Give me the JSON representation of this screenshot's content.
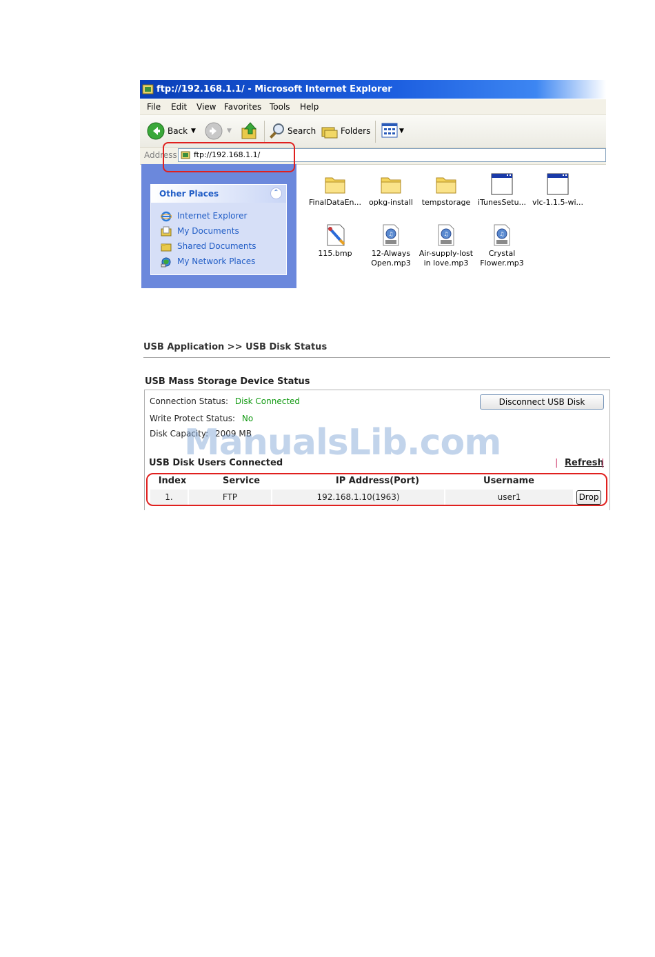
{
  "browser": {
    "title": "ftp://192.168.1.1/ - Microsoft Internet Explorer",
    "menu": [
      "File",
      "Edit",
      "View",
      "Favorites",
      "Tools",
      "Help"
    ],
    "toolbar": {
      "back_label": "Back",
      "search_label": "Search",
      "folders_label": "Folders"
    },
    "address": {
      "label": "Address",
      "value": "ftp://192.168.1.1/"
    },
    "other_places": {
      "title": "Other Places",
      "links": [
        "Internet Explorer",
        "My Documents",
        "Shared Documents",
        "My Network Places"
      ]
    },
    "files": [
      {
        "name": "FinalDataEn...",
        "icon": "folder-icon"
      },
      {
        "name": "opkg-install",
        "icon": "folder-icon"
      },
      {
        "name": "tempstorage",
        "icon": "folder-icon"
      },
      {
        "name": "iTunesSetu...",
        "icon": "application-icon"
      },
      {
        "name": "vlc-1.1.5-wi...",
        "icon": "application-icon"
      },
      {
        "name": "115.bmp",
        "icon": "bitmap-icon"
      },
      {
        "name": "12-Always Open.mp3",
        "icon": "mp3-icon"
      },
      {
        "name": "Air-supply-lost in love.mp3",
        "icon": "mp3-icon"
      },
      {
        "name": "Crystal Flower.mp3",
        "icon": "mp3-icon"
      }
    ]
  },
  "router": {
    "breadcrumb": "USB Application >> USB Disk Status",
    "section_title": "USB Mass Storage Device Status",
    "connection_label": "Connection Status:",
    "connection_value": "Disk Connected",
    "write_protect_label": "Write Protect Status:",
    "write_protect_value": "No",
    "capacity_label": "Disk Capacity:",
    "capacity_value": "2009 MB",
    "disconnect_button": "Disconnect USB Disk",
    "users_title": "USB Disk Users Connected",
    "refresh_label": "Refresh",
    "table": {
      "headers": [
        "Index",
        "Service",
        "IP Address(Port)",
        "Username"
      ],
      "rows": [
        {
          "index": "1.",
          "service": "FTP",
          "ip": "192.168.1.10(1963)",
          "username": "user1",
          "action": "Drop"
        }
      ]
    }
  },
  "watermark": "ManualsLib.com",
  "colors": {
    "link": "#215dc6",
    "status_green": "#119911",
    "callout": "#e0201e",
    "title_bar": "#0a3fb8"
  }
}
